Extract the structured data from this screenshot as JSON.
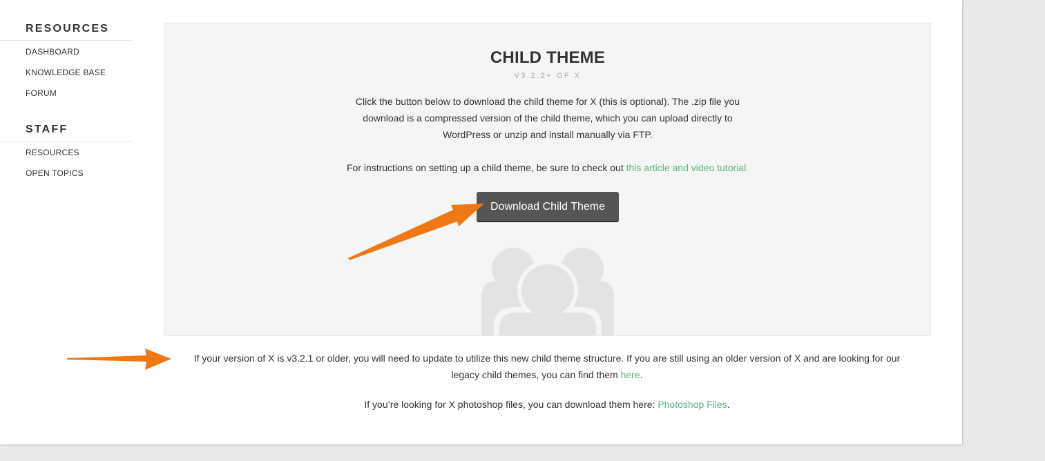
{
  "sidebar": {
    "resources_heading": "RESOURCES",
    "resources_items": [
      "DASHBOARD",
      "KNOWLEDGE BASE",
      "FORUM"
    ],
    "staff_heading": "STAFF",
    "staff_items": [
      "RESOURCES",
      "OPEN TOPICS"
    ]
  },
  "panel": {
    "title": "CHILD THEME",
    "subtitle": "V3.2.2+ OF X",
    "description_lines": [
      "Click the button below to download the child theme for X (this is optional). The .zip file you",
      "download is a compressed version of the child theme, which you can upload directly to",
      "WordPress or unzip and install manually via FTP."
    ],
    "instructions_prefix": "For instructions on setting up a child theme, be sure to check out ",
    "instructions_link": "this article and video tutorial.",
    "download_button": "Download Child Theme",
    "illustration_icon": "people-group-icon"
  },
  "legacy": {
    "line1": "If your version of X is v3.2.1 or older, you will need to update to utilize this new child theme structure. If you are still using an older version of X and are looking for our",
    "line2_prefix": "legacy child themes, you can find them ",
    "link": "here",
    "line2_suffix": "."
  },
  "photoshop": {
    "prefix": "If you’re looking for X photoshop files, you can download them here: ",
    "link": "Photoshop Files",
    "suffix": "."
  },
  "colors": {
    "link": "#5ab47f",
    "button": "#555555",
    "annotation_arrow": "#f07814"
  },
  "annotations": [
    "arrow-icon",
    "arrow-icon"
  ]
}
